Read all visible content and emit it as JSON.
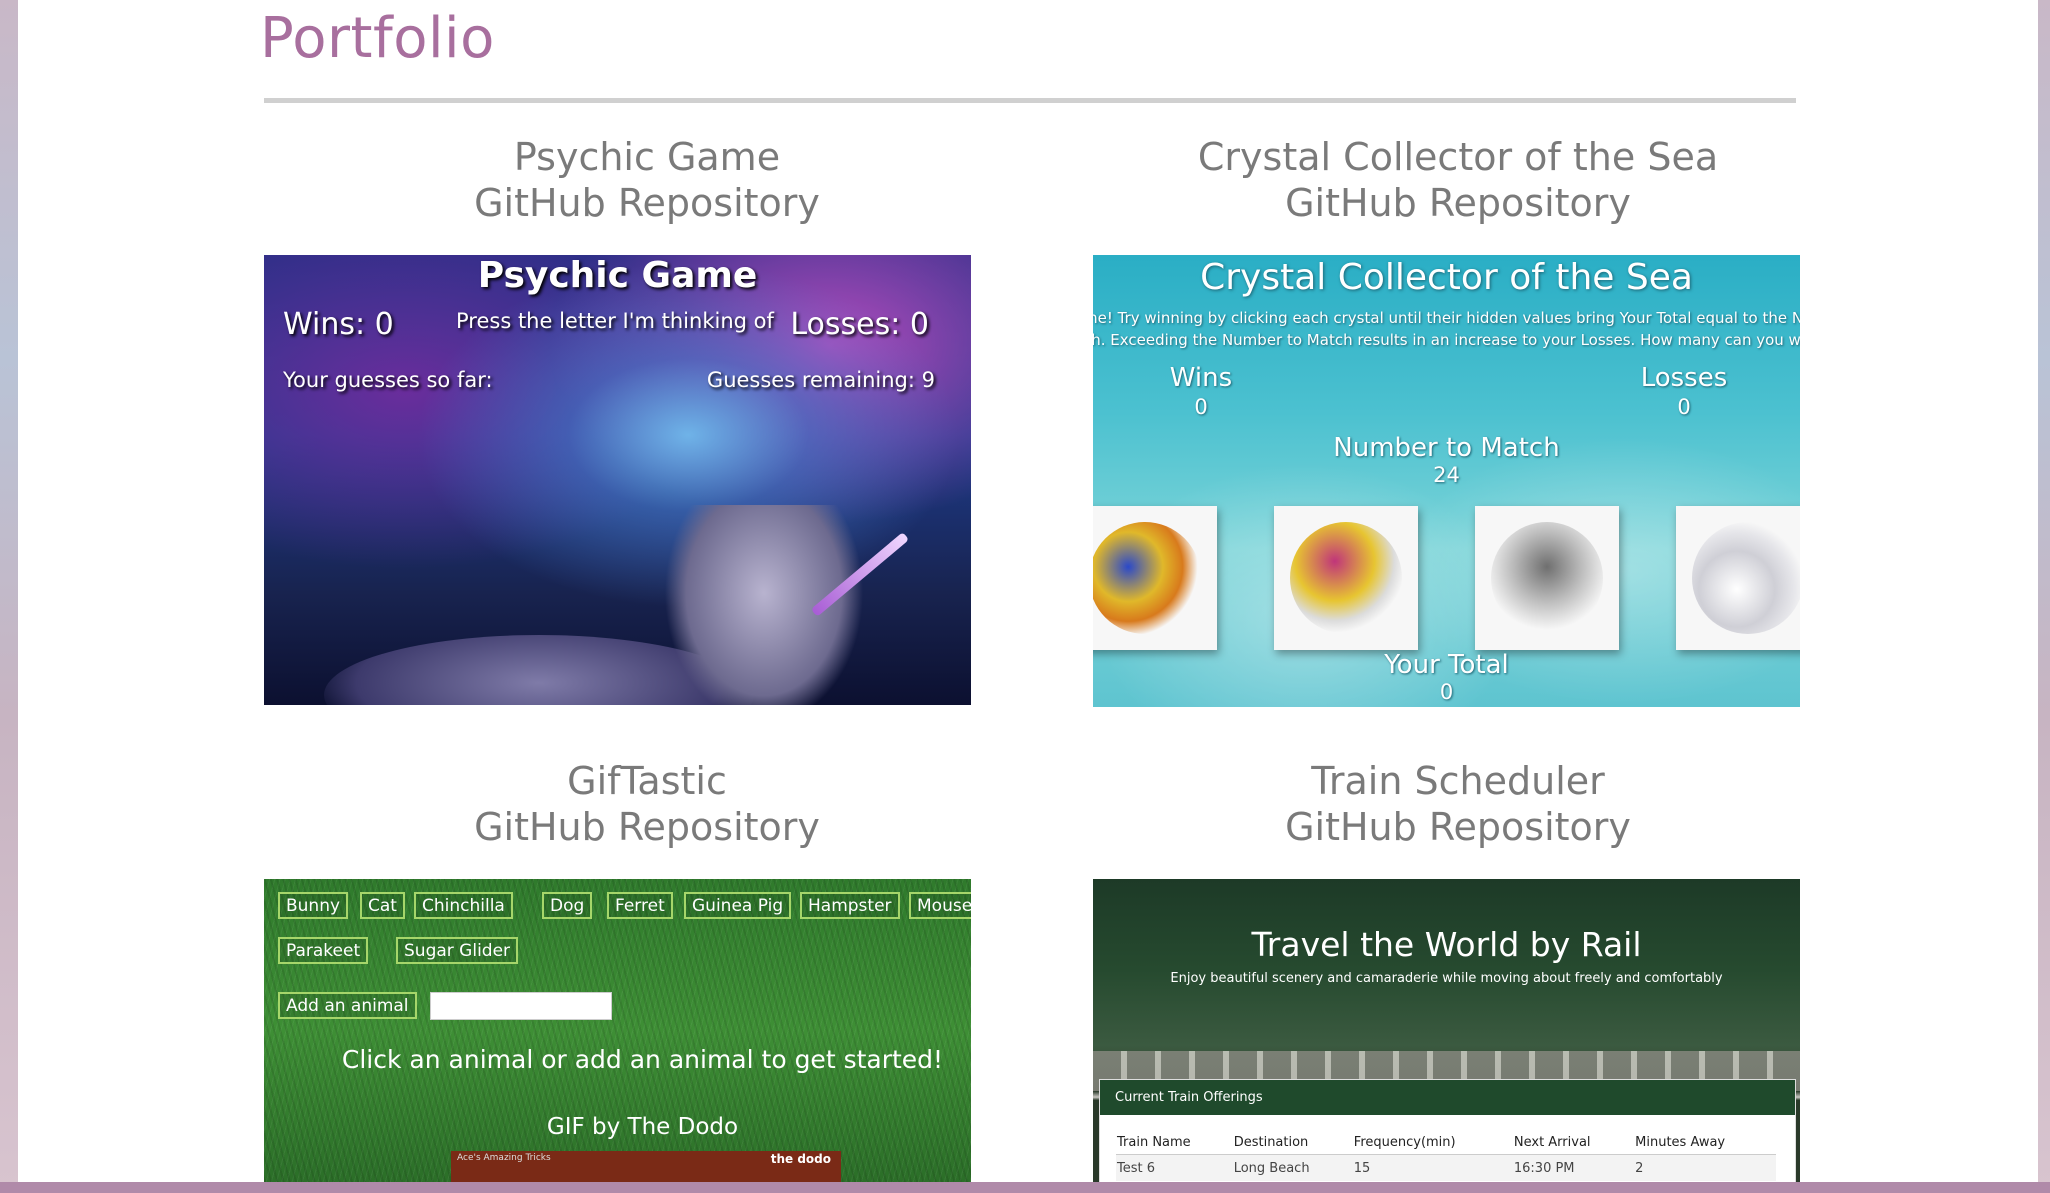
{
  "portfolio": {
    "title": "Portfolio",
    "projects": [
      {
        "name": "Psychic Game",
        "repo_link": "GitHub Repository",
        "preview": {
          "title": "Psychic Game",
          "wins": "Wins: 0",
          "prompt": "Press the letter I'm thinking of",
          "losses": "Losses: 0",
          "guesses": "Your guesses so far:",
          "remaining": "Guesses remaining: 9"
        }
      },
      {
        "name": "Crystal Collector of the Sea",
        "repo_link": "GitHub Repository",
        "preview": {
          "title": "Crystal Collector of the Sea",
          "desc_line1": "me! Try winning by clicking each crystal until their hidden values bring Your Total equal to the Nu",
          "desc_line2": "ch. Exceeding the Number to Match results in an increase to your Losses. How many can you win?",
          "wins_label": "Wins",
          "wins_value": "0",
          "losses_label": "Losses",
          "losses_value": "0",
          "match_label": "Number to Match",
          "match_value": "24",
          "total_label": "Your Total",
          "total_value": "0"
        }
      },
      {
        "name": "GifTastic",
        "repo_link": "GitHub Repository",
        "preview": {
          "animals": [
            "Bunny",
            "Cat",
            "Chinchilla",
            "Dog",
            "Ferret",
            "Guinea Pig",
            "Hampster",
            "Mouse",
            "Parakeet",
            "Sugar Glider"
          ],
          "add_button": "Add an animal",
          "message": "Click an animal or add an animal to get started!",
          "gif_by": "GIF by The Dodo",
          "thumb_label": "Ace's Amazing Tricks",
          "logo_text": "the dodo"
        }
      },
      {
        "name": "Train Scheduler",
        "repo_link": "GitHub Repository",
        "preview": {
          "title": "Travel the World by Rail",
          "subtitle": "Enjoy beautiful scenery and camaraderie while moving about freely and comfortably",
          "panel_title": "Current Train Offerings",
          "columns": [
            "Train Name",
            "Destination",
            "Frequency(min)",
            "Next Arrival",
            "Minutes Away"
          ],
          "rows": [
            [
              "Test 6",
              "Long Beach",
              "15",
              "16:30 PM",
              "2"
            ]
          ]
        }
      }
    ]
  }
}
